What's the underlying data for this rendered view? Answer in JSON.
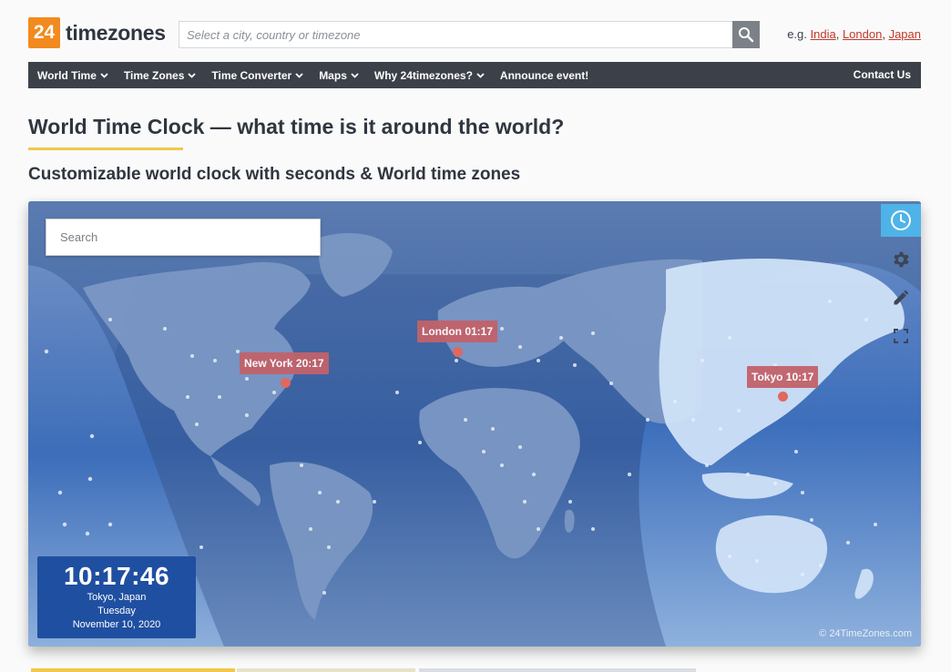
{
  "header": {
    "logo_number": "24",
    "logo_text": "timezones",
    "search_placeholder": "Select a city, country or timezone",
    "examples_prefix": "e.g.",
    "examples": [
      "India",
      "London",
      "Japan"
    ]
  },
  "nav": {
    "items": [
      "World Time",
      "Time Zones",
      "Time Converter",
      "Maps",
      "Why 24timezones?",
      "Announce event!"
    ],
    "contact": "Contact Us"
  },
  "page": {
    "title": "World Time Clock — what time is it around the world?",
    "subtitle": "Customizable world clock with seconds & World time zones"
  },
  "map": {
    "search_placeholder": "Search",
    "cities": [
      {
        "label": "London 01:17"
      },
      {
        "label": "New York 20:17"
      },
      {
        "label": "Tokyo 10:17"
      }
    ],
    "clock": {
      "time": "10:17:46",
      "place": "Tokyo, Japan",
      "day": "Tuesday",
      "date": "November 10, 2020"
    },
    "copyright": "© 24TimeZones.com"
  },
  "colors": {
    "brand_orange": "#f28a1f",
    "nav_bg": "#3c4149",
    "accent_yellow": "#f2c84b",
    "label_red": "#c2626a",
    "clock_bg": "#1f4fa0",
    "clock_button": "#4fb3e8"
  }
}
